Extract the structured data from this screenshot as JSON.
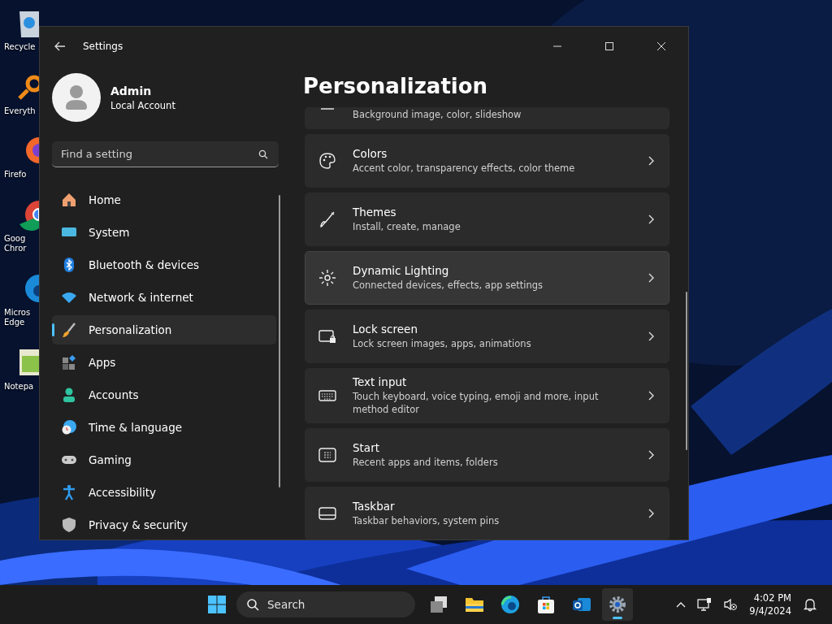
{
  "desktop_icons": [
    {
      "label": "Recycle"
    },
    {
      "label": "Everyth"
    },
    {
      "label": "Firefo"
    },
    {
      "label": "Goog\nChror"
    },
    {
      "label": "Micros\nEdge"
    },
    {
      "label": "Notepa"
    }
  ],
  "window": {
    "title": "Settings"
  },
  "account": {
    "name": "Admin",
    "type": "Local Account"
  },
  "search": {
    "placeholder": "Find a setting"
  },
  "nav": [
    {
      "label": "Home",
      "selected": false
    },
    {
      "label": "System",
      "selected": false
    },
    {
      "label": "Bluetooth & devices",
      "selected": false
    },
    {
      "label": "Network & internet",
      "selected": false
    },
    {
      "label": "Personalization",
      "selected": true
    },
    {
      "label": "Apps",
      "selected": false
    },
    {
      "label": "Accounts",
      "selected": false
    },
    {
      "label": "Time & language",
      "selected": false
    },
    {
      "label": "Gaming",
      "selected": false
    },
    {
      "label": "Accessibility",
      "selected": false
    },
    {
      "label": "Privacy & security",
      "selected": false
    }
  ],
  "page_title": "Personalization",
  "cards": [
    {
      "subtitle": "Background image, color, slideshow",
      "hovered": false
    },
    {
      "title": "Colors",
      "subtitle": "Accent color, transparency effects, color theme",
      "hovered": false
    },
    {
      "title": "Themes",
      "subtitle": "Install, create, manage",
      "hovered": false
    },
    {
      "title": "Dynamic Lighting",
      "subtitle": "Connected devices, effects, app settings",
      "hovered": true
    },
    {
      "title": "Lock screen",
      "subtitle": "Lock screen images, apps, animations",
      "hovered": false
    },
    {
      "title": "Text input",
      "subtitle": "Touch keyboard, voice typing, emoji and more, input method editor",
      "hovered": false
    },
    {
      "title": "Start",
      "subtitle": "Recent apps and items, folders",
      "hovered": false
    },
    {
      "title": "Taskbar",
      "subtitle": "Taskbar behaviors, system pins",
      "hovered": false
    }
  ],
  "taskbar": {
    "search_placeholder": "Search",
    "apps": [
      {
        "active": false
      },
      {
        "active": false
      },
      {
        "active": false
      },
      {
        "active": false
      },
      {
        "active": false
      },
      {
        "active": true
      }
    ],
    "time": "4:02 PM",
    "date": "9/4/2024"
  }
}
